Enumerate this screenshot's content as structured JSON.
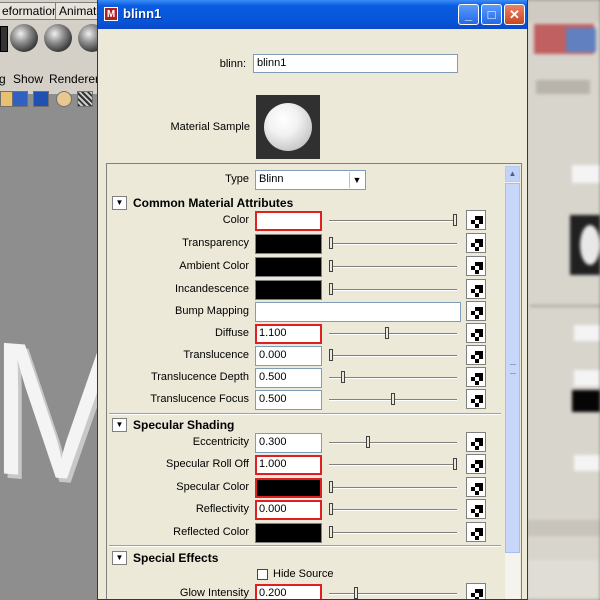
{
  "window": {
    "title": "blinn1"
  },
  "background": {
    "tabs": [
      "eformation",
      "Animatio"
    ],
    "menu": [
      "g",
      "Show",
      "Renderer"
    ],
    "viewport_letter": "M"
  },
  "node": {
    "label": "blinn:",
    "value": "blinn1"
  },
  "sample": {
    "label": "Material Sample"
  },
  "type": {
    "label": "Type",
    "value": "Blinn"
  },
  "sections": {
    "common": "Common Material Attributes",
    "specular": "Specular Shading",
    "effects": "Special Effects"
  },
  "common_attrs": [
    {
      "label": "Color",
      "kind": "color",
      "color": "#ffffff",
      "level": 1.0
    },
    {
      "label": "Transparency",
      "kind": "color",
      "color": "#000000",
      "level": 0.0
    },
    {
      "label": "Ambient Color",
      "kind": "color",
      "color": "#000000",
      "level": 0.0
    },
    {
      "label": "Incandescence",
      "kind": "color",
      "color": "#000000",
      "level": 0.0
    },
    {
      "label": "Bump Mapping",
      "kind": "bump"
    },
    {
      "label": "Diffuse",
      "kind": "num",
      "value": "1.100",
      "level": 0.45
    },
    {
      "label": "Translucence",
      "kind": "num",
      "value": "0.000",
      "level": 0.0
    },
    {
      "label": "Translucence Depth",
      "kind": "num",
      "value": "0.500",
      "level": 0.1
    },
    {
      "label": "Translucence Focus",
      "kind": "num",
      "value": "0.500",
      "level": 0.5
    }
  ],
  "specular_attrs": [
    {
      "label": "Eccentricity",
      "kind": "num",
      "value": "0.300",
      "level": 0.3
    },
    {
      "label": "Specular Roll Off",
      "kind": "num",
      "value": "1.000",
      "level": 1.0
    },
    {
      "label": "Specular Color",
      "kind": "color",
      "color": "#000000",
      "level": 0.0
    },
    {
      "label": "Reflectivity",
      "kind": "num",
      "value": "0.000",
      "level": 0.0
    },
    {
      "label": "Reflected Color",
      "kind": "color",
      "color": "#000000",
      "level": 0.0
    }
  ],
  "effects": {
    "hide_source_label": "Hide Source",
    "hide_source_checked": false,
    "glow": {
      "label": "Glow Intensity",
      "value": "0.200",
      "level": 0.2
    }
  },
  "colors": {
    "title_bar": "#0a5ce0",
    "highlight_border": "#e02020",
    "dialog_bg": "#ece9d8"
  }
}
